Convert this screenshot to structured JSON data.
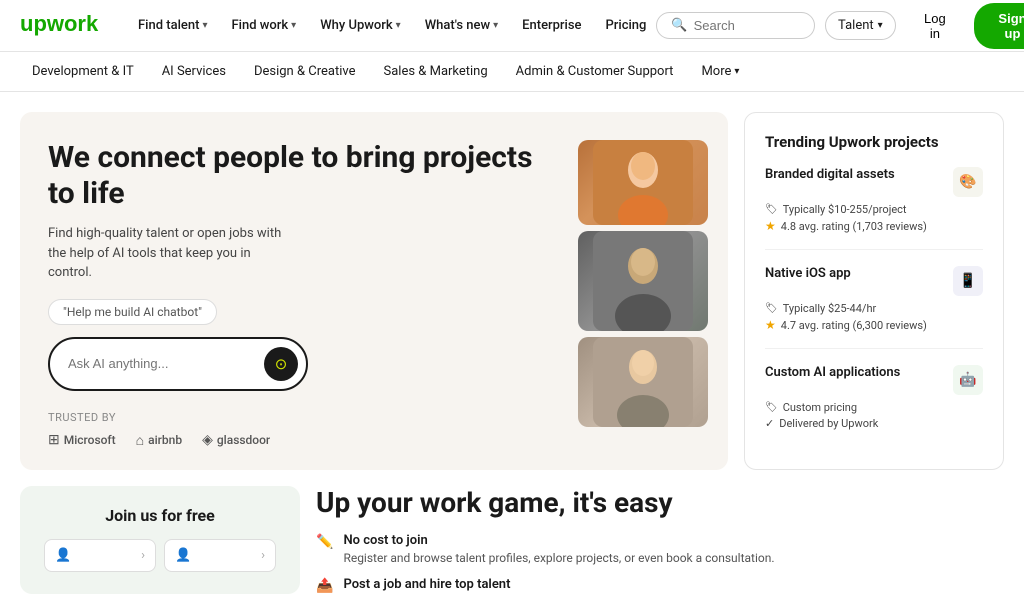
{
  "topnav": {
    "logo_text": "upwork",
    "links": [
      {
        "label": "Find talent",
        "has_dropdown": true
      },
      {
        "label": "Find work",
        "has_dropdown": true
      },
      {
        "label": "Why Upwork",
        "has_dropdown": true
      },
      {
        "label": "What's new",
        "has_dropdown": true
      },
      {
        "label": "Enterprise",
        "has_dropdown": false
      },
      {
        "label": "Pricing",
        "has_dropdown": false
      }
    ],
    "search_placeholder": "Search",
    "talent_label": "Talent",
    "login_label": "Log in",
    "signup_label": "Sign up"
  },
  "subnav": {
    "links": [
      {
        "label": "Development & IT",
        "active": false
      },
      {
        "label": "AI Services",
        "active": false
      },
      {
        "label": "Design & Creative",
        "active": false
      },
      {
        "label": "Sales & Marketing",
        "active": false
      },
      {
        "label": "Admin & Customer Support",
        "active": false
      }
    ],
    "more_label": "More"
  },
  "hero": {
    "title": "We connect people to bring projects to life",
    "subtitle": "Find high-quality talent or open jobs with the help of AI tools that keep you in control.",
    "suggestion": "\"Help me build AI chatbot\"",
    "search_placeholder": "Ask AI anything...",
    "trusted_label": "TRUSTED BY",
    "trusted_logos": [
      {
        "name": "Microsoft"
      },
      {
        "name": "airbnb"
      },
      {
        "name": "glassdoor"
      }
    ]
  },
  "trending": {
    "title": "Trending Upwork projects",
    "projects": [
      {
        "name": "Branded digital assets",
        "icon": "🎨",
        "price": "Typically $10-255/project",
        "rating": "4.8 avg. rating (1,703 reviews)"
      },
      {
        "name": "Native iOS app",
        "icon": "📱",
        "price": "Typically $25-44/hr",
        "rating": "4.7 avg. rating (6,300 reviews)"
      },
      {
        "name": "Custom AI applications",
        "icon": "🤖",
        "price": "Custom pricing",
        "delivered": "Delivered by Upwork"
      }
    ]
  },
  "bottom": {
    "join_title": "Join us for free",
    "game_title": "Up your work game, it's easy",
    "game_items": [
      {
        "title": "No cost to join",
        "desc": "Register and browse talent profiles, explore projects, or even book a consultation."
      },
      {
        "title": "Post a job and hire top talent",
        "desc": ""
      }
    ]
  }
}
